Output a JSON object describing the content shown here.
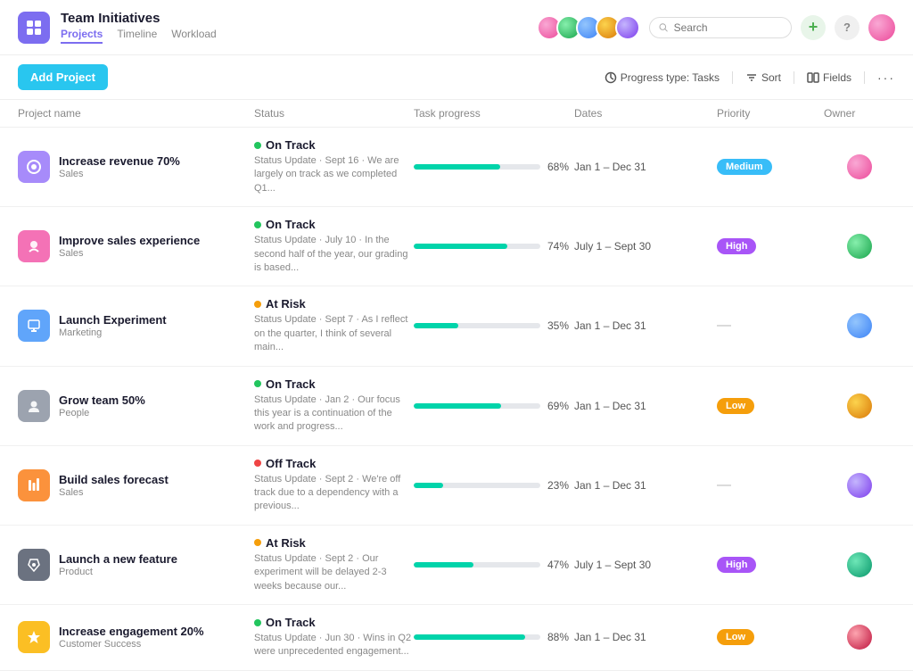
{
  "app": {
    "logo_alt": "Team Initiatives Logo",
    "title": "Team Initiatives",
    "nav": [
      {
        "label": "Projects",
        "active": true
      },
      {
        "label": "Timeline",
        "active": false
      },
      {
        "label": "Workload",
        "active": false
      }
    ]
  },
  "toolbar": {
    "add_project_label": "Add Project",
    "progress_type_label": "Progress type: Tasks",
    "sort_label": "Sort",
    "fields_label": "Fields"
  },
  "table": {
    "headers": [
      "Project name",
      "Status",
      "Task progress",
      "Dates",
      "Priority",
      "Owner"
    ],
    "rows": [
      {
        "icon_color": "purple",
        "name": "Increase revenue 70%",
        "category": "Sales",
        "status_type": "green",
        "status_text": "On Track",
        "status_update": "Status Update · Sept 16 · We are largely on track as we completed Q1...",
        "progress": 68,
        "dates": "Jan 1 – Dec 31",
        "priority": "medium",
        "priority_text": "Medium",
        "owner_class": "av1"
      },
      {
        "icon_color": "pink",
        "name": "Improve sales experience",
        "category": "Sales",
        "status_type": "green",
        "status_text": "On Track",
        "status_update": "Status Update · July 10 · In the second half of the year, our grading is based...",
        "progress": 74,
        "dates": "July 1 – Sept 30",
        "priority": "high",
        "priority_text": "High",
        "owner_class": "av2"
      },
      {
        "icon_color": "blue",
        "name": "Launch Experiment",
        "category": "Marketing",
        "status_type": "orange",
        "status_text": "At Risk",
        "status_update": "Status Update · Sept 7 · As I reflect on the quarter, I think of several main...",
        "progress": 35,
        "dates": "Jan 1 – Dec 31",
        "priority": "dash",
        "priority_text": "—",
        "owner_class": "av3"
      },
      {
        "icon_color": "gray",
        "name": "Grow team 50%",
        "category": "People",
        "status_type": "green",
        "status_text": "On Track",
        "status_update": "Status Update · Jan 2 · Our focus this year is a continuation of the work and progress...",
        "progress": 69,
        "dates": "Jan 1 – Dec 31",
        "priority": "low",
        "priority_text": "Low",
        "owner_class": "av4"
      },
      {
        "icon_color": "orange",
        "name": "Build sales forecast",
        "category": "Sales",
        "status_type": "red",
        "status_text": "Off Track",
        "status_update": "Status Update · Sept 2 · We're off track due to a dependency with a previous...",
        "progress": 23,
        "dates": "Jan 1 – Dec 31",
        "priority": "dash",
        "priority_text": "—",
        "owner_class": "av5"
      },
      {
        "icon_color": "dark-gray",
        "name": "Launch a new feature",
        "category": "Product",
        "status_type": "orange",
        "status_text": "At Risk",
        "status_update": "Status Update · Sept 2 · Our experiment will be delayed 2-3 weeks because our...",
        "progress": 47,
        "dates": "July 1 – Sept 30",
        "priority": "high",
        "priority_text": "High",
        "owner_class": "av6"
      },
      {
        "icon_color": "yellow",
        "name": "Increase engagement 20%",
        "category": "Customer Success",
        "status_type": "green",
        "status_text": "On Track",
        "status_update": "Status Update · Jun 30 · Wins in Q2 were unprecedented engagement...",
        "progress": 88,
        "dates": "Jan 1 – Dec 31",
        "priority": "low",
        "priority_text": "Low",
        "owner_class": "av7"
      }
    ]
  },
  "search": {
    "placeholder": "Search"
  }
}
